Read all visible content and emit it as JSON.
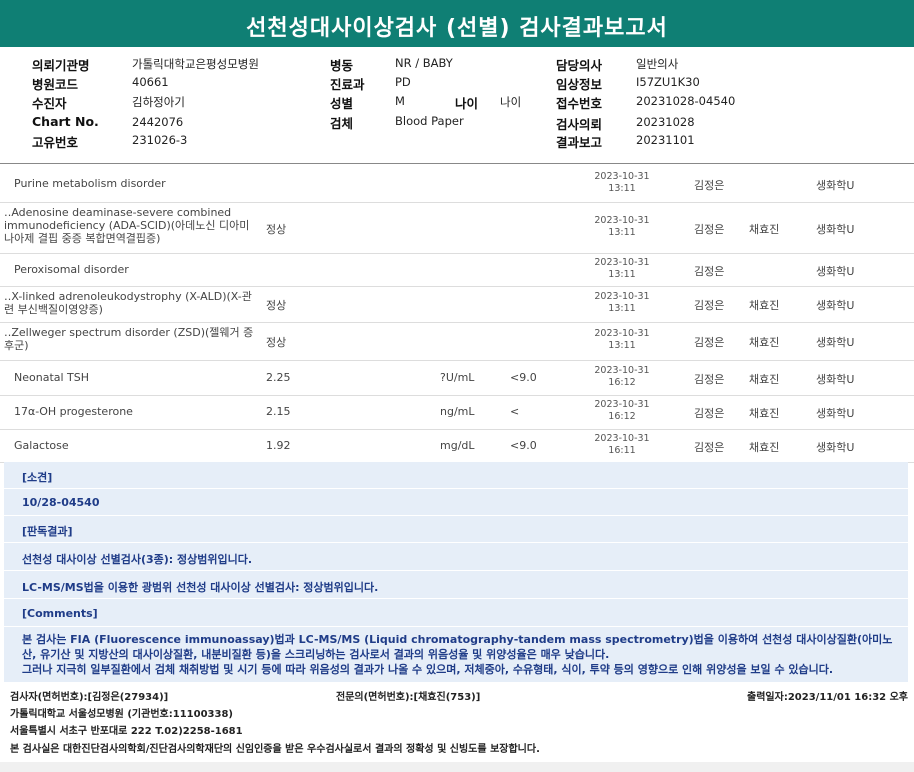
{
  "title": "선천성대사이상검사 (선별) 검사결과보고서",
  "header": {
    "col1": [
      {
        "label": "의뢰기관명",
        "value": "가톨릭대학교은평성모병원"
      },
      {
        "label": "병원코드",
        "value": "40661"
      },
      {
        "label": "수진자",
        "value": "김하정아기"
      },
      {
        "label": "Chart No.",
        "value": "2442076"
      },
      {
        "label": "고유번호",
        "value": "231026-3"
      }
    ],
    "col2": [
      {
        "label": "병동",
        "value": "NR / BABY"
      },
      {
        "label": "진료과",
        "value": "PD"
      },
      {
        "label": "성별",
        "value": "M"
      },
      {
        "label": "검체",
        "value": "Blood Paper"
      }
    ],
    "age": {
      "label": "나이",
      "value": "나이"
    },
    "col3": [
      {
        "label": "담당의사",
        "value": "일반의사"
      },
      {
        "label": "임상정보",
        "value": "I57ZU1K30"
      },
      {
        "label": "접수번호",
        "value": "20231028-04540"
      },
      {
        "label": "검사의뢰",
        "value": "20231028"
      },
      {
        "label": "결과보고",
        "value": "20231101"
      }
    ]
  },
  "rows": [
    {
      "name": "Purine metabolism disorder",
      "result": "",
      "unit": "",
      "ref": "",
      "date": "2023-10-31",
      "time": "13:11",
      "tester": "김정은",
      "reviewer": "",
      "dept": "생화학U"
    },
    {
      "name": "‥Adenosine deaminase-severe combined immunodeficiency (ADA-SCID)(아데노신 디아미나아제 결핍 중증 복합면역결핍증)",
      "result": "정상",
      "unit": "",
      "ref": "",
      "date": "2023-10-31",
      "time": "13:11",
      "tester": "김정은",
      "reviewer": "채효진",
      "dept": "생화학U"
    },
    {
      "name": "Peroxisomal disorder",
      "result": "",
      "unit": "",
      "ref": "",
      "date": "2023-10-31",
      "time": "13:11",
      "tester": "김정은",
      "reviewer": "",
      "dept": "생화학U"
    },
    {
      "name": "‥X-linked adrenoleukodystrophy (X-ALD)(X-관련 부신백질이영양증)",
      "result": "정상",
      "unit": "",
      "ref": "",
      "date": "2023-10-31",
      "time": "13:11",
      "tester": "김정은",
      "reviewer": "채효진",
      "dept": "생화학U"
    },
    {
      "name": "‥Zellweger spectrum disorder (ZSD)(젤웨거 증후군)",
      "result": "정상",
      "unit": "",
      "ref": "",
      "date": "2023-10-31",
      "time": "13:11",
      "tester": "김정은",
      "reviewer": "채효진",
      "dept": "생화학U"
    },
    {
      "name": "Neonatal TSH",
      "result": "2.25",
      "unit": "?U/mL",
      "ref": "<9.0",
      "date": "2023-10-31",
      "time": "16:12",
      "tester": "김정은",
      "reviewer": "채효진",
      "dept": "생화학U"
    },
    {
      "name": "17α-OH progesterone",
      "result": "2.15",
      "unit": "ng/mL",
      "ref": "<",
      "date": "2023-10-31",
      "time": "16:12",
      "tester": "김정은",
      "reviewer": "채효진",
      "dept": "생화학U"
    },
    {
      "name": "Galactose",
      "result": "1.92",
      "unit": "mg/dL",
      "ref": "<9.0",
      "date": "2023-10-31",
      "time": "16:11",
      "tester": "김정은",
      "reviewer": "채효진",
      "dept": "생화학U"
    }
  ],
  "findings": {
    "opinion_label": "[소견]",
    "opinion_value": "10/28-04540",
    "judgement_label": "[판독결과]",
    "judgement_1": "선천성 대사이상 선별검사(3종): 정상범위입니다.",
    "judgement_2": "LC-MS/MS법을 이용한 광범위 선천성 대사이상 선별검사: 정상범위입니다.",
    "comments_label": "[Comments]",
    "comments_text": "본 검사는 FIA (Fluorescence immunoassay)법과 LC-MS/MS (Liquid chromatography-tandem mass spectrometry)법을 이용하여 선천성 대사이상질환(아미노산, 유기산 및 지방산의 대사이상질환, 내분비질환 등)을 스크리닝하는 검사로서 결과의 위음성율 및 위양성율은 매우 낮습니다.\n그러나 지극히 일부질환에서 검체 채취방법 및 시기 등에 따라 위음성의 결과가 나올 수 있으며, 저체중아, 수유형태, 식이, 투약 등의 영향으로 인해 위양성을 보일 수 있습니다."
  },
  "footer": {
    "tester": "검사자(면허번호):[김정은(27934)]",
    "specialist": "전문의(면허번호):[채효진(753)]",
    "printed": "출력일자:2023/11/01 16:32 오후",
    "org": "가톨릭대학교 서울성모병원 (기관번호:11100338)",
    "address": "서울특별시 서초구 반포대로 222 T.02)2258-1681",
    "cert": "본 검사실은 대한진단검사의학회/진단검사의학재단의 신임인증을 받은 우수검사실로서 결과의 정확성 및 신빙도를 보장합니다."
  }
}
